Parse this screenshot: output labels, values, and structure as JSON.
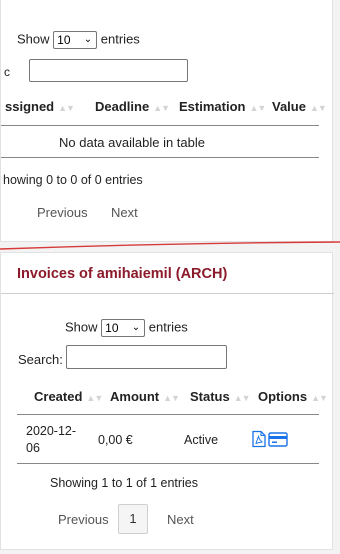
{
  "top_table": {
    "show_label": "Show",
    "entries_value": "10",
    "entries_label": "entries",
    "search_label_partial": "c",
    "columns": [
      "ssigned",
      "Deadline",
      "Estimation",
      "Value"
    ],
    "empty_message": "No data available in table",
    "info": "howing 0 to 0 of 0 entries",
    "prev": "Previous",
    "next": "Next"
  },
  "bottom_section": {
    "title": "Invoices of amihaiemil (ARCH)",
    "show_label": "Show",
    "entries_value": "10",
    "entries_label": "entries",
    "search_label": "Search:",
    "columns": [
      "Created",
      "Amount",
      "Status",
      "Options"
    ],
    "rows": [
      {
        "created": "2020-12-06",
        "amount": "0,00 €",
        "status": "Active",
        "options": [
          "pdf-icon",
          "credit-card-icon"
        ]
      }
    ],
    "info": "Showing 1 to 1 of 1 entries",
    "prev": "Previous",
    "page": "1",
    "next": "Next"
  },
  "colors": {
    "title": "#8b1a2b",
    "divider": "#d63a3a",
    "icon": "#1a73e8"
  }
}
